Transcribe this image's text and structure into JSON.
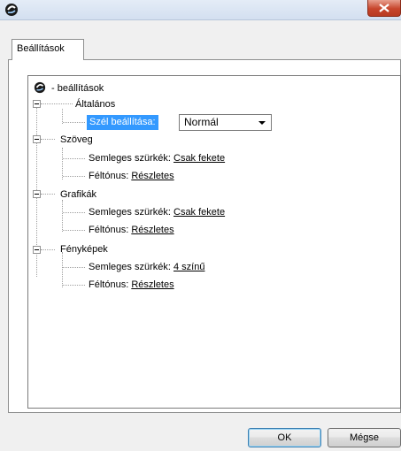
{
  "tab": {
    "label": "Beállítások"
  },
  "tree": {
    "root_label": "- beállítások",
    "general": {
      "label": "Általános",
      "edge_label": "Szél beállítása:",
      "edge_value": "Normál"
    },
    "text": {
      "label": "Szöveg",
      "gray_label": "Semleges szürkék:",
      "gray_value": "Csak fekete",
      "halftone_label": "Féltónus:",
      "halftone_value": "Részletes"
    },
    "graphics": {
      "label": "Grafikák",
      "gray_label": "Semleges szürkék:",
      "gray_value": "Csak fekete",
      "halftone_label": "Féltónus:",
      "halftone_value": "Részletes"
    },
    "photos": {
      "label": "Fényképek",
      "gray_label": "Semleges szürkék:",
      "gray_value": "4 színű",
      "halftone_label": "Féltónus:",
      "halftone_value": "Részletes"
    }
  },
  "buttons": {
    "ok": "OK",
    "cancel": "Mégse"
  },
  "colors": {
    "selection": "#3399ff",
    "close": "#c7452c"
  }
}
